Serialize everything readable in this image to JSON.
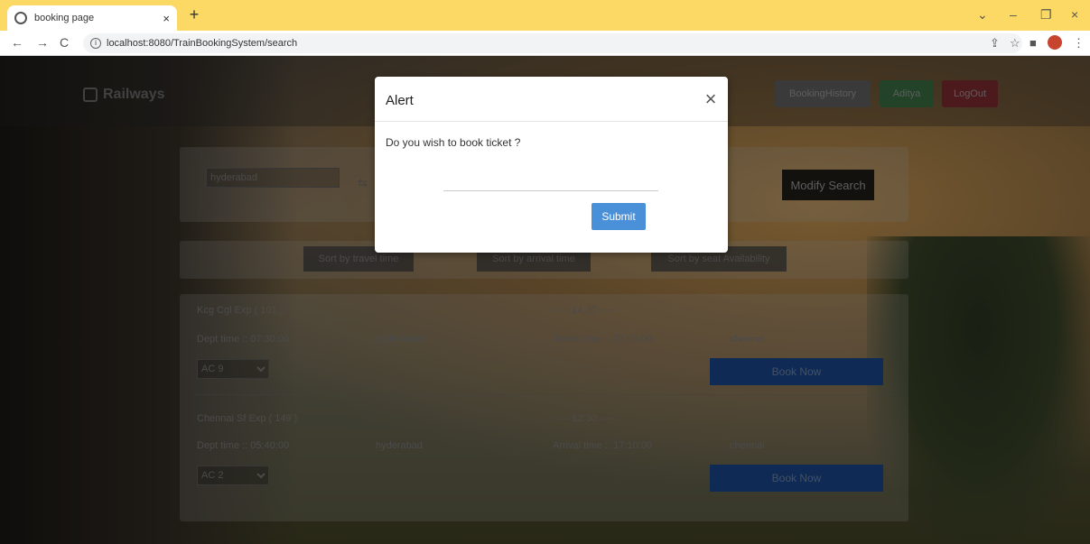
{
  "browser": {
    "tab_title": "booking page",
    "tab_close": "×",
    "new_tab": "+",
    "url": "localhost:8080/TrainBookingSystem/search",
    "back": "←",
    "forward": "→",
    "reload": "C",
    "win_collapse": "⌄",
    "win_minimize": "–",
    "win_restore": "❐",
    "win_close": "×",
    "share": "⇪",
    "bookmark": "☆",
    "sidebar": "■",
    "more": "⋮"
  },
  "navbar": {
    "brand": "Railways",
    "booking_history": "BookingHistory",
    "user": "Aditya",
    "logout": "LogOut"
  },
  "search": {
    "from_value": "hyderabad",
    "swap": "⇆",
    "modify_label": "Modify Search"
  },
  "sort": {
    "travel_time": "Sort by travel time",
    "arrival_time": "Sort by arrival time",
    "seat_availability": "Sort by seat Availability"
  },
  "trains": [
    {
      "name": "Kcg Cgl Exp ( 101 )",
      "duration": "----- 14:30 -----",
      "dept": "Dept time :: 07:30:00",
      "from": "hyderabad",
      "arrival": "Arrival time :: 17:00:00",
      "to": "chennai",
      "class": "AC 9",
      "book_label": "Book Now"
    },
    {
      "name": "Chennai Sf Exp ( 149 )",
      "duration": "----- 12:30 -----",
      "dept": "Dept time :: 05:40:00",
      "from": "hyderabad",
      "arrival": "Arrival time :: 17:10:00",
      "to": "chennai",
      "class": "AC 2",
      "book_label": "Book Now"
    }
  ],
  "modal": {
    "title": "Alert",
    "close": "×",
    "message": "Do you wish to book ticket ?",
    "submit_label": "Submit"
  },
  "colors": {
    "tabbar": "#fbd964",
    "history_btn": "#6b6b6b",
    "user_btn": "#3f7a4a",
    "logout_btn": "#8a2f33",
    "book_btn": "#1a4e9c",
    "submit_btn": "#4a90d9"
  }
}
